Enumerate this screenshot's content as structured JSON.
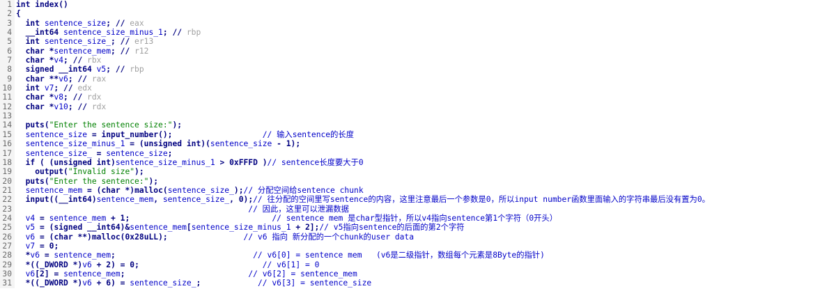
{
  "editor": {
    "lines": [
      {
        "n": "1",
        "segs": [
          [
            "kw",
            "int "
          ],
          [
            "fn",
            "index"
          ],
          [
            "p",
            "()"
          ]
        ]
      },
      {
        "n": "2",
        "segs": [
          [
            "p",
            "{"
          ]
        ]
      },
      {
        "n": "3",
        "segs": [
          [
            "kw",
            "  int "
          ],
          [
            "v",
            "sentence_size"
          ],
          [
            "p",
            "; "
          ],
          [
            "cc",
            "// "
          ],
          [
            "cg",
            "eax"
          ]
        ]
      },
      {
        "n": "4",
        "segs": [
          [
            "kw",
            "  __int64 "
          ],
          [
            "v",
            "sentence_size_minus_1"
          ],
          [
            "p",
            "; "
          ],
          [
            "cc",
            "// "
          ],
          [
            "cg",
            "rbp"
          ]
        ]
      },
      {
        "n": "5",
        "segs": [
          [
            "kw",
            "  int "
          ],
          [
            "v",
            "sentence_size_"
          ],
          [
            "p",
            "; "
          ],
          [
            "cc",
            "// "
          ],
          [
            "cg",
            "er13"
          ]
        ]
      },
      {
        "n": "6",
        "segs": [
          [
            "kw",
            "  char "
          ],
          [
            "p",
            "*"
          ],
          [
            "v",
            "sentence_mem"
          ],
          [
            "p",
            "; "
          ],
          [
            "cc",
            "// "
          ],
          [
            "cg",
            "r12"
          ]
        ]
      },
      {
        "n": "7",
        "segs": [
          [
            "kw",
            "  char "
          ],
          [
            "p",
            "*"
          ],
          [
            "v",
            "v4"
          ],
          [
            "p",
            "; "
          ],
          [
            "cc",
            "// "
          ],
          [
            "cg",
            "rbx"
          ]
        ]
      },
      {
        "n": "8",
        "segs": [
          [
            "kw",
            "  signed __int64 "
          ],
          [
            "v",
            "v5"
          ],
          [
            "p",
            "; "
          ],
          [
            "cc",
            "// "
          ],
          [
            "cg",
            "rbp"
          ]
        ]
      },
      {
        "n": "9",
        "segs": [
          [
            "kw",
            "  char "
          ],
          [
            "p",
            "**"
          ],
          [
            "v",
            "v6"
          ],
          [
            "p",
            "; "
          ],
          [
            "cc",
            "// "
          ],
          [
            "cg",
            "rax"
          ]
        ]
      },
      {
        "n": "10",
        "segs": [
          [
            "kw",
            "  int "
          ],
          [
            "v",
            "v7"
          ],
          [
            "p",
            "; "
          ],
          [
            "cc",
            "// "
          ],
          [
            "cg",
            "edx"
          ]
        ]
      },
      {
        "n": "11",
        "segs": [
          [
            "kw",
            "  char "
          ],
          [
            "p",
            "*"
          ],
          [
            "v",
            "v8"
          ],
          [
            "p",
            "; "
          ],
          [
            "cc",
            "// "
          ],
          [
            "cg",
            "rdx"
          ]
        ]
      },
      {
        "n": "12",
        "segs": [
          [
            "kw",
            "  char "
          ],
          [
            "p",
            "*"
          ],
          [
            "v",
            "v10"
          ],
          [
            "p",
            "; "
          ],
          [
            "cc",
            "// "
          ],
          [
            "cg",
            "rdx"
          ]
        ]
      },
      {
        "n": "13",
        "segs": []
      },
      {
        "n": "14",
        "segs": [
          [
            "fn",
            "  puts"
          ],
          [
            "p",
            "("
          ],
          [
            "s",
            "\"Enter the sentence size:\""
          ],
          [
            "p",
            ");"
          ]
        ]
      },
      {
        "n": "15",
        "segs": [
          [
            "v",
            "  sentence_size"
          ],
          [
            "p",
            " = "
          ],
          [
            "fn",
            "input_number"
          ],
          [
            "p",
            "();"
          ],
          [
            "p",
            "                   "
          ],
          [
            "c",
            "// 输入sentence的长度"
          ]
        ]
      },
      {
        "n": "16",
        "segs": [
          [
            "v",
            "  sentence_size_minus_1"
          ],
          [
            "p",
            " = ("
          ],
          [
            "kw",
            "unsigned int"
          ],
          [
            "p",
            ")("
          ],
          [
            "v",
            "sentence_size"
          ],
          [
            "p",
            " - "
          ],
          [
            "n",
            "1"
          ],
          [
            "p",
            ");"
          ]
        ]
      },
      {
        "n": "17",
        "segs": [
          [
            "v",
            "  sentence_size_"
          ],
          [
            "p",
            " = "
          ],
          [
            "v",
            "sentence_size"
          ],
          [
            "p",
            ";"
          ]
        ]
      },
      {
        "n": "18",
        "segs": [
          [
            "kw",
            "  if "
          ],
          [
            "p",
            "( ("
          ],
          [
            "kw",
            "unsigned int"
          ],
          [
            "p",
            ")"
          ],
          [
            "v",
            "sentence_size_minus_1"
          ],
          [
            "p",
            " > "
          ],
          [
            "n",
            "0xFFFD"
          ],
          [
            "p",
            " )"
          ],
          [
            "c",
            "// sentence长度要大于0"
          ]
        ]
      },
      {
        "n": "19",
        "segs": [
          [
            "fn",
            "    output"
          ],
          [
            "p",
            "("
          ],
          [
            "s",
            "\"Invalid size\""
          ],
          [
            "p",
            ");"
          ]
        ]
      },
      {
        "n": "20",
        "segs": [
          [
            "fn",
            "  puts"
          ],
          [
            "p",
            "("
          ],
          [
            "s",
            "\"Enter the sentence:\""
          ],
          [
            "p",
            ");"
          ]
        ]
      },
      {
        "n": "21",
        "segs": [
          [
            "v",
            "  sentence_mem"
          ],
          [
            "p",
            " = ("
          ],
          [
            "kw",
            "char "
          ],
          [
            "p",
            "*)"
          ],
          [
            "fn",
            "malloc"
          ],
          [
            "p",
            "("
          ],
          [
            "v",
            "sentence_size_"
          ],
          [
            "p",
            ");"
          ],
          [
            "c",
            "// 分配空间给sentence chunk"
          ]
        ]
      },
      {
        "n": "22",
        "segs": [
          [
            "fn",
            "  input"
          ],
          [
            "p",
            "(("
          ],
          [
            "kw",
            "__int64"
          ],
          [
            "p",
            ")"
          ],
          [
            "v",
            "sentence_mem"
          ],
          [
            "p",
            ", "
          ],
          [
            "v",
            "sentence_size_"
          ],
          [
            "p",
            ", "
          ],
          [
            "n",
            "0"
          ],
          [
            "p",
            ");"
          ],
          [
            "c",
            "// 往分配的空间里写sentence的内容，这里注意最后一个参数是0，所以input number函数里面输入的字符串最后没有置为0。"
          ]
        ]
      },
      {
        "n": "23",
        "segs": [
          [
            "p",
            "                                                 "
          ],
          [
            "c",
            "// 因此，这里可以泄漏数据"
          ]
        ]
      },
      {
        "n": "24",
        "segs": [
          [
            "v",
            "  v4"
          ],
          [
            "p",
            " = "
          ],
          [
            "v",
            "sentence_mem"
          ],
          [
            "p",
            " + "
          ],
          [
            "n",
            "1"
          ],
          [
            "p",
            ";"
          ],
          [
            "p",
            "                              "
          ],
          [
            "c",
            "// sentence mem 是char型指针，所以v4指向sentence第1个字符（0开头）"
          ]
        ]
      },
      {
        "n": "25",
        "segs": [
          [
            "v",
            "  v5"
          ],
          [
            "p",
            " = ("
          ],
          [
            "kw",
            "signed __int64"
          ],
          [
            "p",
            ")&"
          ],
          [
            "v",
            "sentence_mem"
          ],
          [
            "p",
            "["
          ],
          [
            "v",
            "sentence_size_minus_1"
          ],
          [
            "p",
            " + "
          ],
          [
            "n",
            "2"
          ],
          [
            "p",
            "];"
          ],
          [
            "c",
            "// v5指向sentence的后面的第2个字符"
          ]
        ]
      },
      {
        "n": "26",
        "segs": [
          [
            "v",
            "  v6"
          ],
          [
            "p",
            " = ("
          ],
          [
            "kw",
            "char "
          ],
          [
            "p",
            "**)"
          ],
          [
            "fn",
            "malloc"
          ],
          [
            "p",
            "("
          ],
          [
            "n",
            "0x28uLL"
          ],
          [
            "p",
            ");"
          ],
          [
            "p",
            "                "
          ],
          [
            "c",
            "// v6 指向 新分配的一个chunk的user data"
          ]
        ]
      },
      {
        "n": "27",
        "segs": [
          [
            "v",
            "  v7"
          ],
          [
            "p",
            " = "
          ],
          [
            "n",
            "0"
          ],
          [
            "p",
            ";"
          ]
        ]
      },
      {
        "n": "28",
        "segs": [
          [
            "p",
            "  *"
          ],
          [
            "v",
            "v6"
          ],
          [
            "p",
            " = "
          ],
          [
            "v",
            "sentence_mem"
          ],
          [
            "p",
            ";"
          ],
          [
            "p",
            "                             "
          ],
          [
            "c",
            "// v6[0] = sentence mem   (v6是二级指针，数组每个元素是8Byte的指针)"
          ]
        ]
      },
      {
        "n": "29",
        "segs": [
          [
            "p",
            "  *(("
          ],
          [
            "kw",
            "_DWORD "
          ],
          [
            "p",
            "*)"
          ],
          [
            "v",
            "v6"
          ],
          [
            "p",
            " + "
          ],
          [
            "n",
            "2"
          ],
          [
            "p",
            ") = "
          ],
          [
            "n",
            "0"
          ],
          [
            "p",
            ";"
          ],
          [
            "p",
            "                          "
          ],
          [
            "c",
            "// v6[1] = 0"
          ]
        ]
      },
      {
        "n": "30",
        "segs": [
          [
            "v",
            "  v6"
          ],
          [
            "p",
            "["
          ],
          [
            "n",
            "2"
          ],
          [
            "p",
            "] = "
          ],
          [
            "v",
            "sentence_mem"
          ],
          [
            "p",
            ";"
          ],
          [
            "p",
            "                          "
          ],
          [
            "c",
            "// v6[2] = sentence_mem"
          ]
        ]
      },
      {
        "n": "31",
        "segs": [
          [
            "p",
            "  *(("
          ],
          [
            "kw",
            "_DWORD "
          ],
          [
            "p",
            "*)"
          ],
          [
            "v",
            "v6"
          ],
          [
            "p",
            " + "
          ],
          [
            "n",
            "6"
          ],
          [
            "p",
            ") = "
          ],
          [
            "v",
            "sentence_size_"
          ],
          [
            "p",
            ";"
          ],
          [
            "p",
            "            "
          ],
          [
            "c",
            "// v6[3] = sentence_size"
          ]
        ]
      }
    ]
  }
}
